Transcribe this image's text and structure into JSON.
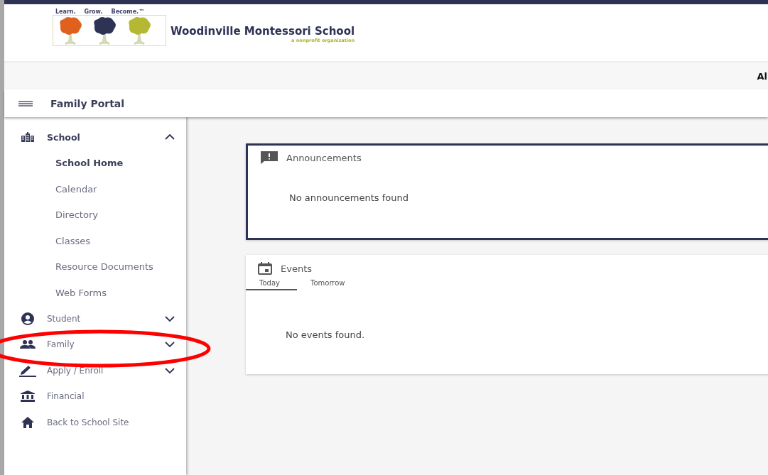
{
  "header": {
    "slogan": [
      "Learn.",
      "Grow.",
      "Become.™"
    ],
    "school_name": "Woodinville Montessori School",
    "tagline": "a nonprofit organization"
  },
  "info_bar": {
    "text": "Al"
  },
  "title_bar": {
    "title": "Family Portal"
  },
  "sidebar": {
    "items": [
      {
        "kind": "group",
        "label": "School",
        "expanded": true,
        "children": [
          {
            "label": "School Home",
            "selected": true
          },
          {
            "label": "Calendar",
            "selected": false
          },
          {
            "label": "Directory",
            "selected": false
          },
          {
            "label": "Classes",
            "selected": false
          },
          {
            "label": "Resource Documents",
            "selected": false
          },
          {
            "label": "Web Forms",
            "selected": false
          }
        ]
      },
      {
        "kind": "group",
        "label": "Student",
        "expanded": false
      },
      {
        "kind": "group",
        "label": "Family",
        "expanded": false
      },
      {
        "kind": "group",
        "label": "Apply / Enroll",
        "expanded": false
      },
      {
        "kind": "link",
        "label": "Financial"
      },
      {
        "kind": "link",
        "label": "Back to School Site"
      }
    ]
  },
  "announcements": {
    "title": "Announcements",
    "message": "No announcements found"
  },
  "events": {
    "title": "Events",
    "tabs": [
      {
        "label": "Today",
        "selected": true
      },
      {
        "label": "Tomorrow",
        "selected": false
      }
    ],
    "message": "No events found."
  },
  "annotation": {
    "kind": "ellipse",
    "color": "#ff0000"
  }
}
